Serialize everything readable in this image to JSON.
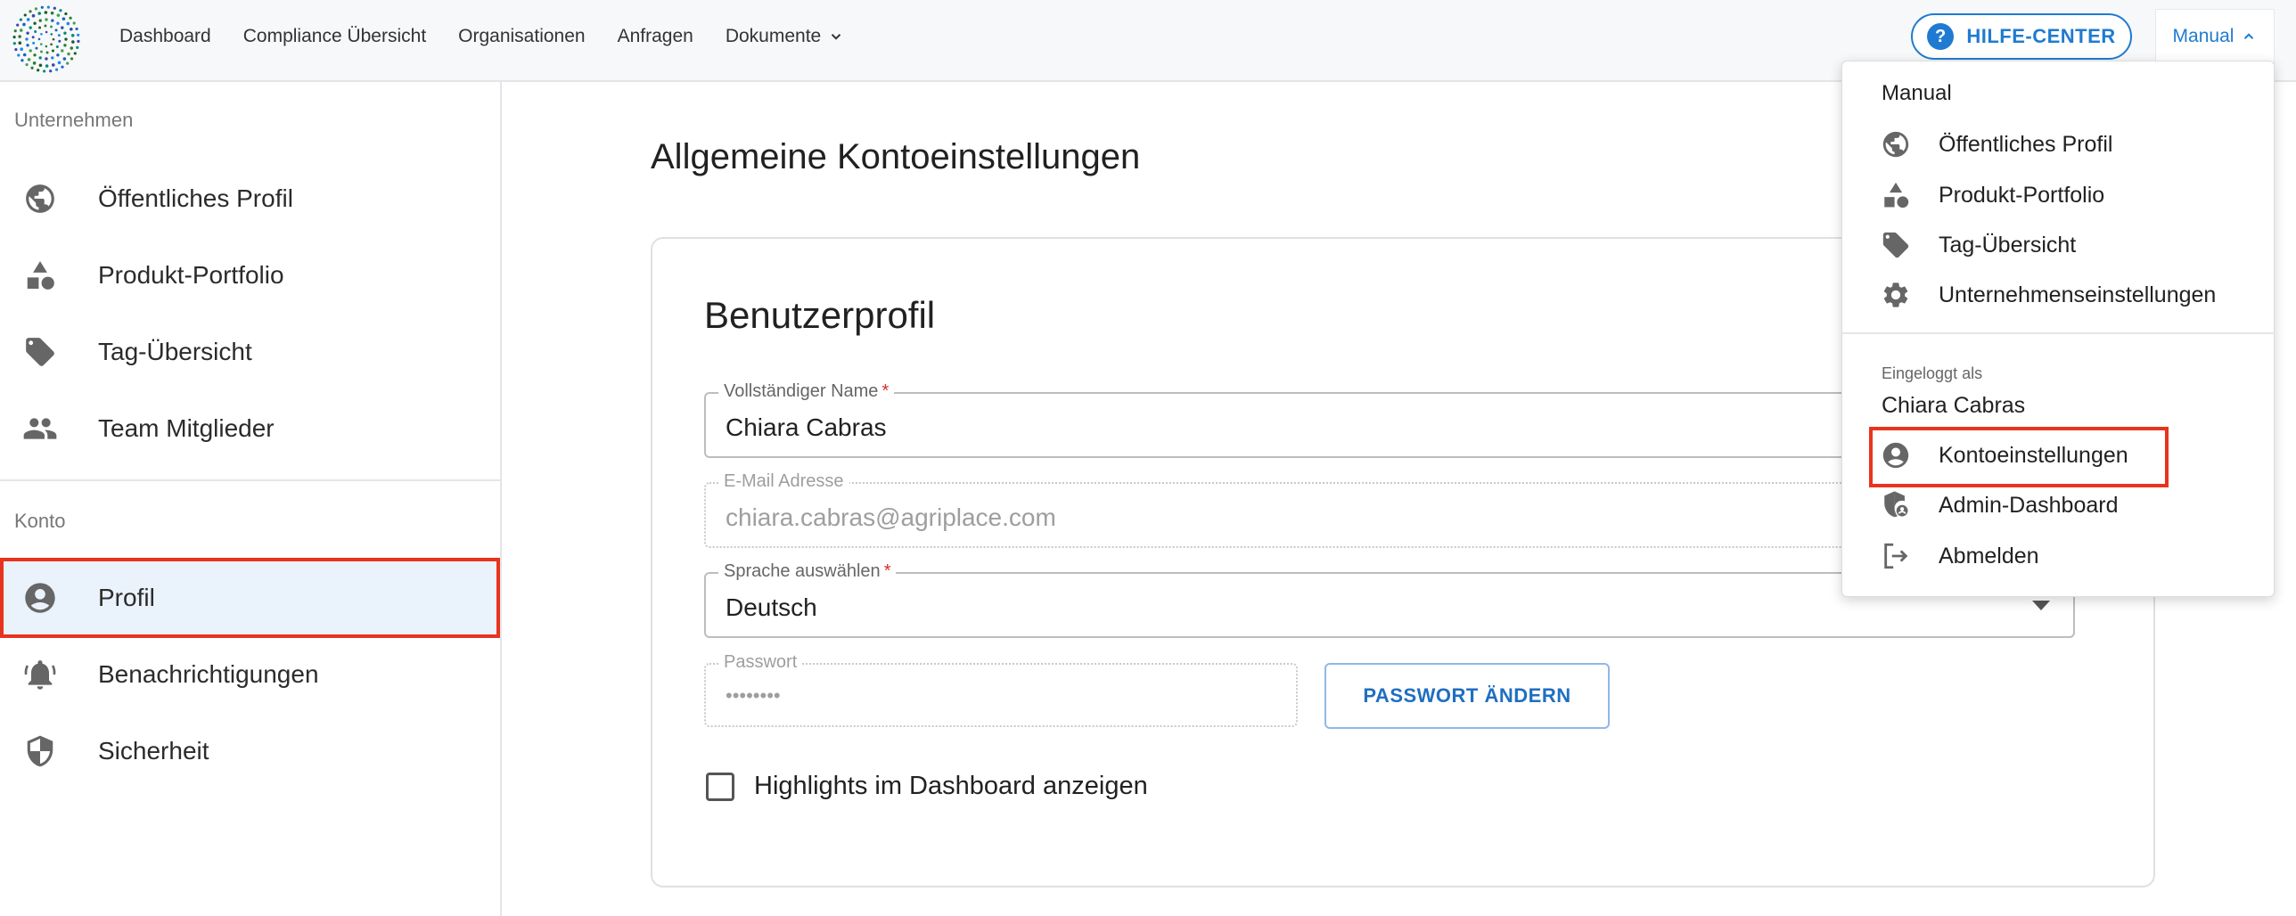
{
  "nav": {
    "items": [
      "Dashboard",
      "Compliance Übersicht",
      "Organisationen",
      "Anfragen",
      "Dokumente"
    ],
    "help_label": "HILFE-CENTER",
    "user_menu_label": "Manual"
  },
  "sidebar": {
    "section_company": "Unternehmen",
    "company_items": [
      {
        "label": "Öffentliches Profil",
        "icon": "globe-icon"
      },
      {
        "label": "Produkt-Portfolio",
        "icon": "shapes-icon"
      },
      {
        "label": "Tag-Übersicht",
        "icon": "tag-icon"
      },
      {
        "label": "Team Mitglieder",
        "icon": "people-icon"
      }
    ],
    "section_account": "Konto",
    "account_items": [
      {
        "label": "Profil",
        "icon": "account-circle-icon",
        "active": true
      },
      {
        "label": "Benachrichtigungen",
        "icon": "bell-icon"
      },
      {
        "label": "Sicherheit",
        "icon": "shield-icon"
      }
    ]
  },
  "main": {
    "page_title": "Allgemeine Kontoeinstellungen",
    "card_title": "Benutzerprofil",
    "fields": {
      "name": {
        "label": "Vollständiger Name",
        "required": "*",
        "value": "Chiara Cabras"
      },
      "email": {
        "label": "E-Mail Adresse",
        "value": "chiara.cabras@agriplace.com"
      },
      "language": {
        "label": "Sprache auswählen",
        "required": "*",
        "value": "Deutsch"
      },
      "password": {
        "label": "Passwort",
        "value": "••••••••"
      }
    },
    "change_password_label": "PASSWORT ÄNDERN",
    "highlights_checkbox": {
      "label": "Highlights im Dashboard anzeigen",
      "checked": false
    }
  },
  "menu": {
    "header": "Manual",
    "company_items": [
      {
        "label": "Öffentliches Profil",
        "icon": "globe-icon"
      },
      {
        "label": "Produkt-Portfolio",
        "icon": "shapes-icon"
      },
      {
        "label": "Tag-Übersicht",
        "icon": "tag-icon"
      },
      {
        "label": "Unternehmenseinstellungen",
        "icon": "gear-icon"
      }
    ],
    "logged_in_as": "Eingeloggt als",
    "user_name": "Chiara Cabras",
    "user_items": [
      {
        "label": "Kontoeinstellungen",
        "icon": "account-circle-icon",
        "highlighted": true
      },
      {
        "label": "Admin-Dashboard",
        "icon": "admin-shield-icon"
      },
      {
        "label": "Abmelden",
        "icon": "logout-icon"
      }
    ]
  },
  "colors": {
    "accent": "#1f7bd1",
    "highlight_border": "#e8331e",
    "active_bg": "#eaf2fb"
  }
}
